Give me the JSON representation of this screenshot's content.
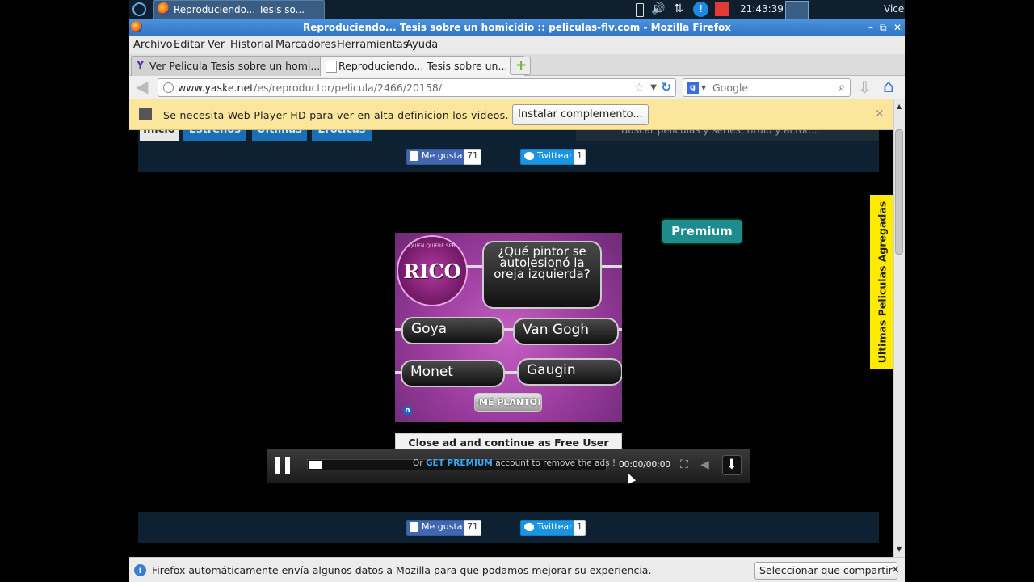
{
  "taskbar": {
    "task_label": "Reproduciendo... Tesis so...",
    "clock": "21:43:39",
    "user": "Vice"
  },
  "window": {
    "title": "Reproduciendo... Tesis sobre un homicidio :: peliculas-flv.com - Mozilla Firefox",
    "minimize": "–",
    "maximize": "⧉",
    "close": "✕"
  },
  "menu": [
    "Archivo",
    "Editar",
    "Ver",
    "Historial",
    "Marcadores",
    "Herramientas",
    "Ayuda"
  ],
  "tabs": [
    {
      "label": "Ver Pelicula Tesis sobre un homi...",
      "close": "✕"
    },
    {
      "label": "Reproduciendo... Tesis sobre un...",
      "close": "✕"
    }
  ],
  "address": {
    "domain": "www.yaske.net",
    "path": "/es/reproductor/pelicula/2466/20158/",
    "search_engine": "Google"
  },
  "notification": {
    "message": "Se necesita Web Player HD para ver en alta definicion los videos.",
    "button": "Instalar complemento...",
    "close": "✕"
  },
  "site_nav": {
    "tabs": [
      "Inicio",
      "Estrenos",
      "Ultimas",
      "Eroticas"
    ],
    "search_placeholder": "Buscar películas y series, título y actor..."
  },
  "share_top": {
    "like_label": "Me gusta",
    "like_count": "71",
    "tweet_label": "Twittear",
    "tweet_count": "1"
  },
  "share_bottom": {
    "like_label": "Me gusta",
    "like_count": "71",
    "tweet_label": "Twittear",
    "tweet_count": "1"
  },
  "ad": {
    "logo": "RICO",
    "logo_ring": "QUIEN QUIERE SER",
    "question": "¿Qué pintor se autolesionó la oreja izquierda?",
    "answers": [
      "Goya",
      "Van Gogh",
      "Monet",
      "Gaugin"
    ],
    "quit": "¡ME PLANTO!",
    "badge": "n"
  },
  "premium_button": "Premium",
  "close_ad_button": "Close ad and continue as Free User",
  "player": {
    "message_prefix": "Or",
    "message_link": "GET PREMIUM",
    "message_suffix": "account to remove the ads !",
    "time": "00:00/00:00"
  },
  "side_tab": "Ultimas Peliculas Agregadas",
  "status": {
    "message": "Firefox automáticamente envía algunos datos a Mozilla para que podamos mejorar su experiencia.",
    "button": "Seleccionar que compartir",
    "close": "✕"
  },
  "colors": {
    "accent": "#1b6fb5",
    "notification": "#fbe69b",
    "premium": "#1e8b8f",
    "side_tab": "#ffeb00"
  }
}
